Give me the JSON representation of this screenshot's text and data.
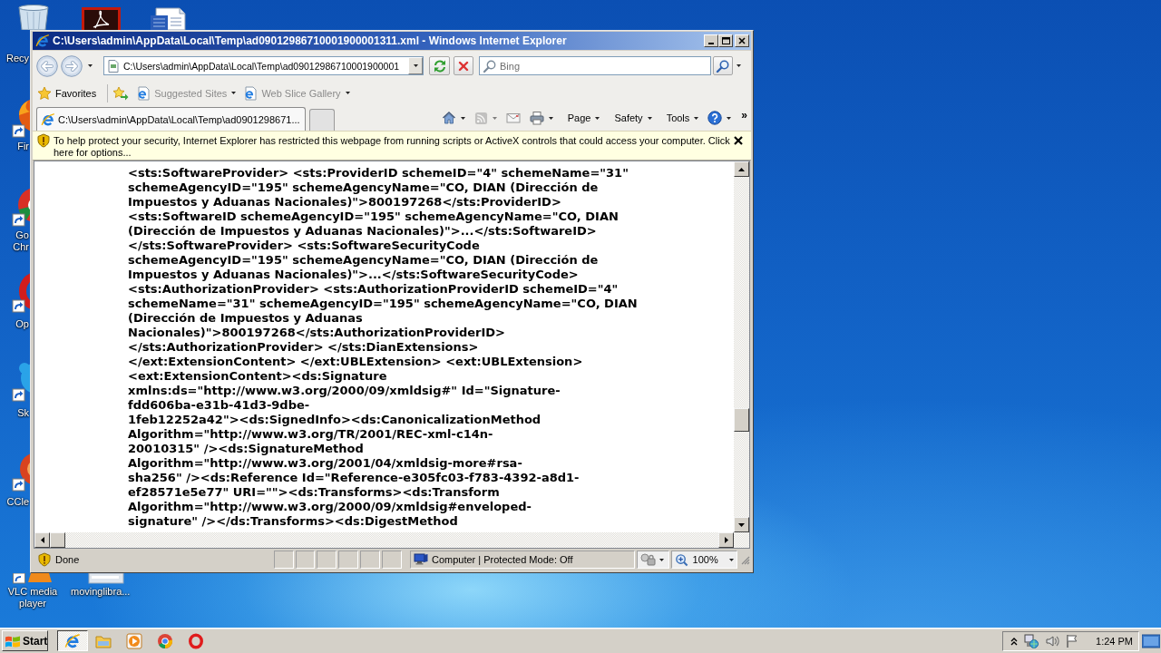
{
  "desktop": {
    "icons": [
      {
        "kind": "recycle",
        "label": "Recy"
      },
      {
        "kind": "pdf"
      },
      {
        "kind": "doc"
      },
      {
        "kind": "firefox",
        "label": "Fir"
      },
      {
        "kind": "chrome",
        "label": "Go Chr"
      },
      {
        "kind": "opera",
        "label": "Op"
      },
      {
        "kind": "skype",
        "label": "Sk"
      },
      {
        "kind": "ccleaner",
        "label": "CCle"
      },
      {
        "kind": "vlc",
        "label": "VLC media player"
      },
      {
        "kind": "file",
        "label": "movinglibra..."
      }
    ]
  },
  "window": {
    "title": "C:\\Users\\admin\\AppData\\Local\\Temp\\ad09012986710001900001311.xml - Windows Internet Explorer",
    "address_bar": {
      "value": "C:\\Users\\admin\\AppData\\Local\\Temp\\ad09012986710001900001"
    },
    "search": {
      "placeholder": "Bing"
    },
    "favorites_bar": {
      "label": "Favorites",
      "items": [
        {
          "label": "Suggested Sites",
          "disabled": true
        },
        {
          "label": "Web Slice Gallery",
          "disabled": true
        }
      ]
    },
    "tabs": [
      {
        "label": "C:\\Users\\admin\\AppData\\Local\\Temp\\ad0901298671...",
        "selected": true
      }
    ],
    "command_bar": {
      "items": [
        {
          "kind": "home",
          "disabled": false
        },
        {
          "kind": "feeds",
          "disabled": true
        },
        {
          "kind": "mail",
          "disabled": false
        },
        {
          "kind": "print",
          "disabled": false
        },
        {
          "kind": "menu",
          "label": "Page",
          "disabled": false
        },
        {
          "kind": "menu",
          "label": "Safety",
          "disabled": false
        },
        {
          "kind": "menu",
          "label": "Tools",
          "disabled": false
        },
        {
          "kind": "help",
          "disabled": false
        }
      ],
      "overflow": "»"
    },
    "info_bar": {
      "text": "To help protect your security, Internet Explorer has restricted this webpage from running scripts or ActiveX controls that could access your computer. Click here for options..."
    },
    "content": {
      "lines": [
        "<sts:SoftwareProvider> <sts:ProviderID schemeID=\"4\" schemeName=\"31\"",
        "schemeAgencyID=\"195\" schemeAgencyName=\"CO, DIAN (Dirección de",
        "Impuestos y Aduanas Nacionales)\">800197268</sts:ProviderID>",
        "<sts:SoftwareID schemeAgencyID=\"195\" schemeAgencyName=\"CO, DIAN",
        "(Dirección de Impuestos y Aduanas Nacionales)\">...</sts:SoftwareID>",
        "</sts:SoftwareProvider> <sts:SoftwareSecurityCode",
        "schemeAgencyID=\"195\" schemeAgencyName=\"CO, DIAN (Dirección de",
        "Impuestos y Aduanas Nacionales)\">...</sts:SoftwareSecurityCode>",
        "<sts:AuthorizationProvider> <sts:AuthorizationProviderID schemeID=\"4\"",
        "schemeName=\"31\" schemeAgencyID=\"195\" schemeAgencyName=\"CO, DIAN",
        "(Dirección de Impuestos y Aduanas",
        "Nacionales)\">800197268</sts:AuthorizationProviderID>",
        "</sts:AuthorizationProvider> </sts:DianExtensions>",
        "</ext:ExtensionContent> </ext:UBLExtension> <ext:UBLExtension>",
        "<ext:ExtensionContent><ds:Signature",
        "xmlns:ds=\"http://www.w3.org/2000/09/xmldsig#\" Id=\"Signature-",
        "fdd606ba-e31b-41d3-9dbe-",
        "1feb12252a42\"><ds:SignedInfo><ds:CanonicalizationMethod",
        "Algorithm=\"http://www.w3.org/TR/2001/REC-xml-c14n-",
        "20010315\" /><ds:SignatureMethod",
        "Algorithm=\"http://www.w3.org/2001/04/xmldsig-more#rsa-",
        "sha256\" /><ds:Reference Id=\"Reference-e305fc03-f783-4392-a8d1-",
        "ef28571e5e77\" URI=\"\"><ds:Transforms><ds:Transform",
        "Algorithm=\"http://www.w3.org/2000/09/xmldsig#enveloped-",
        "signature\" /></ds:Transforms><ds:DigestMethod"
      ]
    },
    "status_bar": {
      "text": "Done",
      "zone": "Computer | Protected Mode: Off",
      "zoom": "100%"
    }
  },
  "taskbar": {
    "start": "Start",
    "apps": [
      {
        "kind": "ie",
        "selected": true
      },
      {
        "kind": "folder",
        "selected": false
      },
      {
        "kind": "media",
        "selected": false
      },
      {
        "kind": "chrome",
        "selected": false
      },
      {
        "kind": "opera",
        "selected": false
      }
    ],
    "clock": "1:24 PM"
  }
}
